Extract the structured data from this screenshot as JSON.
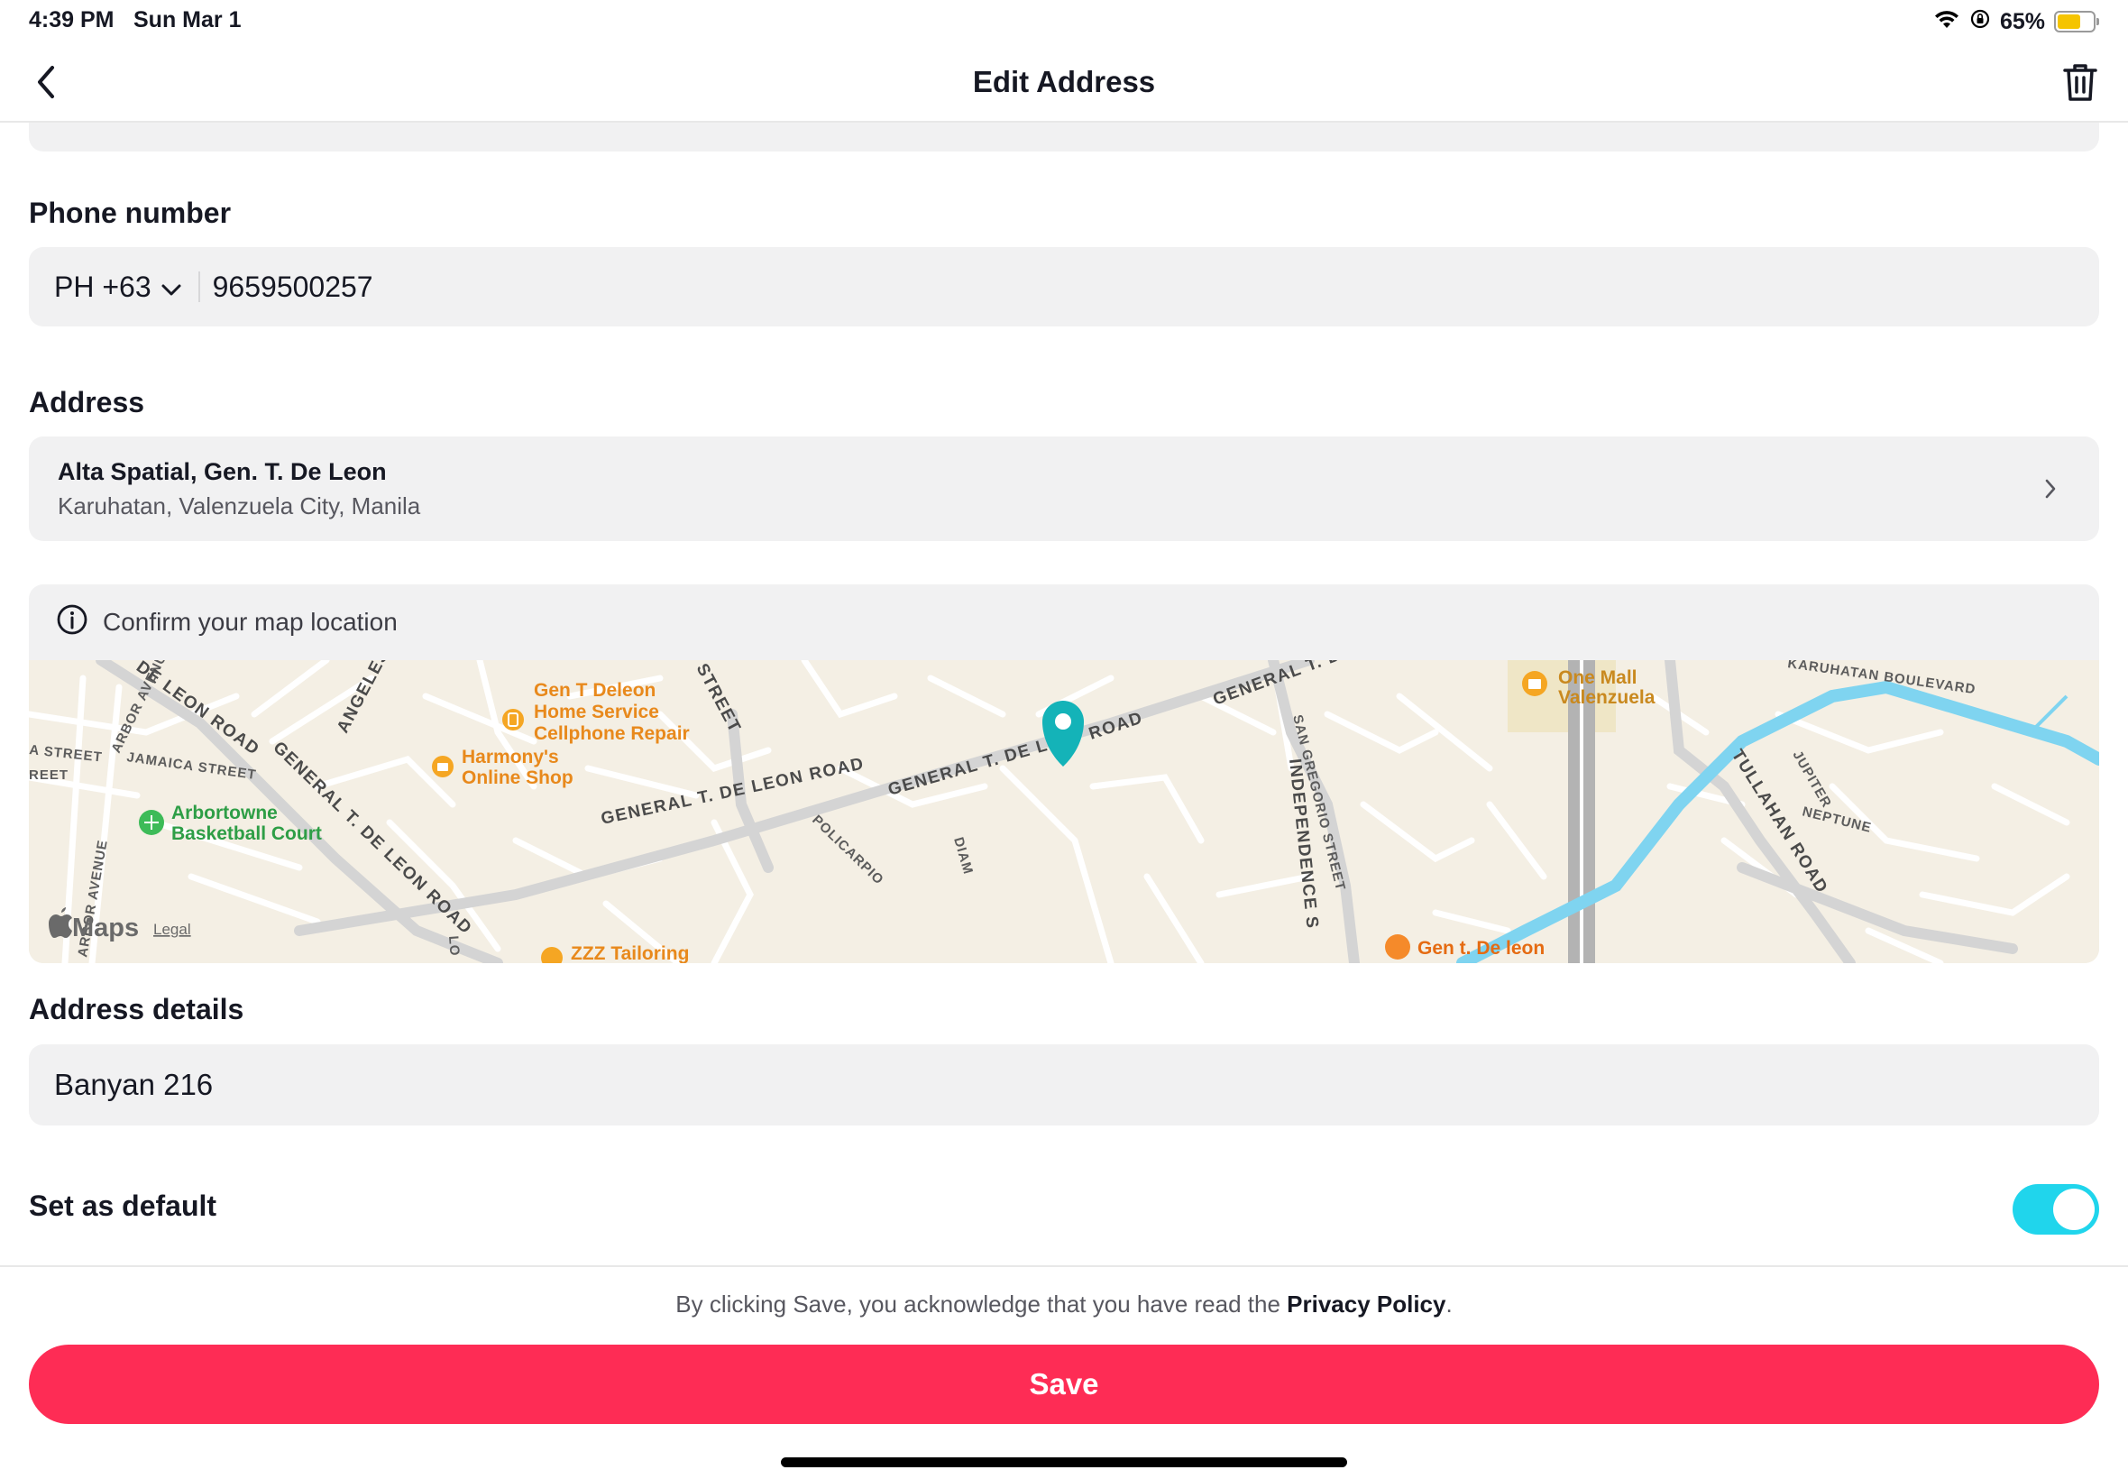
{
  "status_bar": {
    "time": "4:39 PM",
    "date": "Sun Mar 1",
    "battery": "65%",
    "battery_level": 0.65,
    "icons": [
      "wifi-icon",
      "orientation-lock-icon",
      "battery-icon"
    ]
  },
  "nav": {
    "title": "Edit Address",
    "back_icon": "chevron-left-icon",
    "delete_icon": "trash-icon"
  },
  "phone": {
    "label": "Phone number",
    "country_code": "PH +63",
    "value": "9659500257"
  },
  "address": {
    "label": "Address",
    "line1": "Alta Spatial, Gen. T. De Leon",
    "line2": "Karuhatan, Valenzuela City, Manila"
  },
  "map": {
    "confirm_text": "Confirm your map location",
    "attribution": "Maps",
    "legal": "Legal",
    "pin_color": "#14b3b8",
    "river_color": "#7fd4f0",
    "road_labels": [
      "GENERAL T. DE LEON ROAD",
      "GENERAL T. DE L",
      "ROAD",
      "GENERAL T. DE LEON",
      "DE LEON ROAD",
      "GENERAL T. DE LEON ROAD",
      "ANGELES STR",
      "STREET",
      "JAMAICA STREET",
      "ARBOR AVENUE",
      "ARBOR AVENUE",
      "A STREET",
      "REET",
      "INDEPENDENCE S",
      "SAN GREGORIO STREET",
      "TULLAHAN ROAD",
      "JUPITER",
      "NEPTUNE",
      "KARUHATAN BOULEVARD",
      "POLICARPIO",
      "DIAM",
      "LO"
    ],
    "places": [
      {
        "name": "Gen T Deleon Home Service Cellphone Repair"
      },
      {
        "name": "Harmony's Online Shop"
      },
      {
        "name": "Arbortowne Basketball Court"
      },
      {
        "name": "ZZZ Tailoring"
      },
      {
        "name": "One Mall Valenzuela"
      },
      {
        "name": "Gen t. De leon"
      }
    ]
  },
  "details": {
    "label": "Address details",
    "value": "Banyan 216"
  },
  "default": {
    "label": "Set as default",
    "enabled": true
  },
  "footer": {
    "privacy_prefix": "By clicking Save, you acknowledge that you have read the ",
    "privacy_link": "Privacy Policy",
    "privacy_suffix": ".",
    "save_label": "Save"
  },
  "colors": {
    "accent": "#fe2c55",
    "toggle_on": "#20d5ec",
    "field_bg": "#f1f1f2"
  }
}
